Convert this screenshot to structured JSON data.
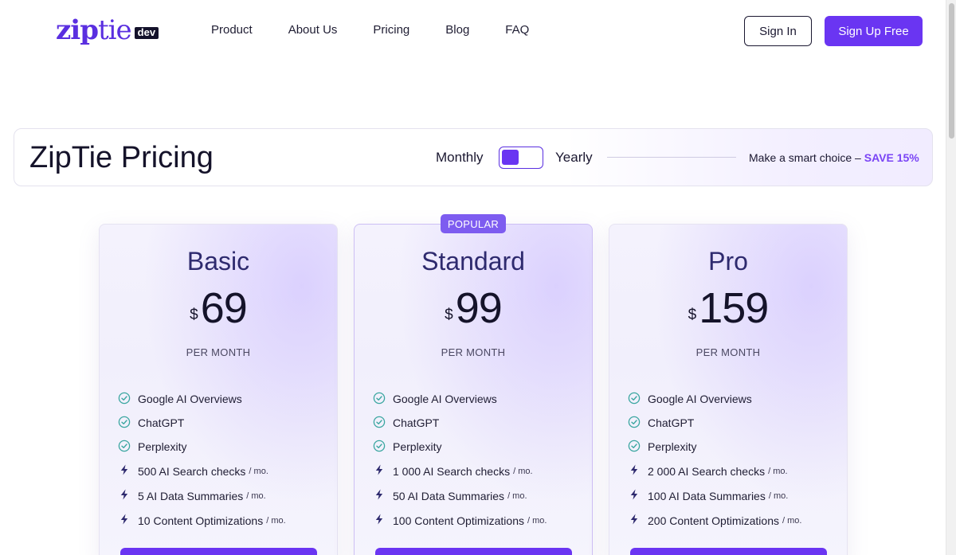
{
  "brand": {
    "logo_main": "zip",
    "logo_light": "tie",
    "logo_badge": "dev"
  },
  "nav": {
    "items": [
      "Product",
      "About Us",
      "Pricing",
      "Blog",
      "FAQ"
    ]
  },
  "auth": {
    "signin_label": "Sign In",
    "signup_label": "Sign Up Free"
  },
  "pricing_bar": {
    "title": "ZipTie Pricing",
    "monthly_label": "Monthly",
    "yearly_label": "Yearly",
    "toggle_selected": "Monthly",
    "promo_text": "Make a smart choice –",
    "promo_save": "SAVE 15%"
  },
  "popular_badge": "POPULAR",
  "plans": [
    {
      "name": "Basic",
      "currency": "$",
      "price": "69",
      "period": "PER MONTH",
      "features": [
        "Google AI Overviews",
        "ChatGPT",
        "Perplexity"
      ],
      "limits": [
        {
          "text": "500 AI Search checks",
          "unit": "/ mo."
        },
        {
          "text": "5 AI Data Summaries",
          "unit": "/ mo."
        },
        {
          "text": "10 Content Optimizations",
          "unit": "/ mo."
        }
      ]
    },
    {
      "name": "Standard",
      "currency": "$",
      "price": "99",
      "period": "PER MONTH",
      "features": [
        "Google AI Overviews",
        "ChatGPT",
        "Perplexity"
      ],
      "limits": [
        {
          "text": "1 000 AI Search checks",
          "unit": "/ mo."
        },
        {
          "text": "50 AI Data Summaries",
          "unit": "/ mo."
        },
        {
          "text": "100 Content Optimizations",
          "unit": "/ mo."
        }
      ]
    },
    {
      "name": "Pro",
      "currency": "$",
      "price": "159",
      "period": "PER MONTH",
      "features": [
        "Google AI Overviews",
        "ChatGPT",
        "Perplexity"
      ],
      "limits": [
        {
          "text": "2 000 AI Search checks",
          "unit": "/ mo."
        },
        {
          "text": "100 AI Data Summaries",
          "unit": "/ mo."
        },
        {
          "text": "200 Content Optimizations",
          "unit": "/ mo."
        }
      ]
    }
  ],
  "colors": {
    "accent": "#6a35f2",
    "plan_title": "#2e2a6e",
    "check": "#3aa6a0",
    "bolt": "#2e2a6e",
    "save": "#7a44f5"
  },
  "icons": {
    "feature": "check-circle-icon",
    "limit": "lightning-bolt-icon"
  }
}
